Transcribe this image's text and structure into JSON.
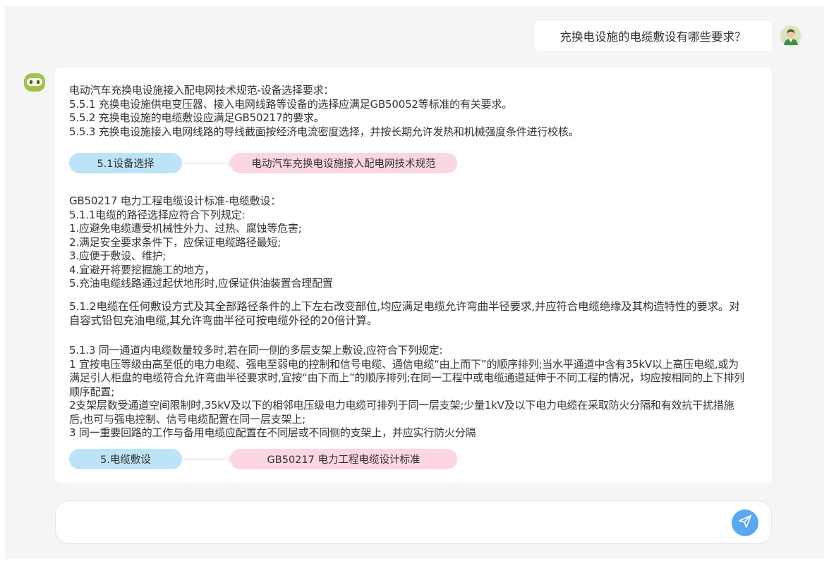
{
  "user_message": {
    "text": "充换电设施的电缆敷设有哪些要求？"
  },
  "bot_message": {
    "paragraph1": "电动汽车充换电设施接入配电网技术规范-设备选择要求：\n5.5.1 充换电设施供电变压器、接入电网线路等设备的选择应满足GB50052等标准的有关要求。\n5.5.2 充换电设施的电缆敷设应满足GB50217的要求。\n5.5.3 充换电设施接入电网线路的导线截面按经济电流密度选择，并按长期允许发热和机械强度条件进行校核。",
    "reference1": {
      "section": "5.1设备选择",
      "standard": "电动汽车充换电设施接入配电网技术规范"
    },
    "paragraph2": "GB50217 电力工程电缆设计标准-电缆敷设：\n5.1.1电缆的路径选择应符合下列规定:\n1.应避免电缆遭受机械性外力、过热、腐蚀等危害;\n2.满足安全要求条件下，应保证电缆路径最短;\n3.应便于敷设、维护;\n4.宜避开将要挖掘施工的地方，\n5.充油电缆线路通过起伏地形时,应保证供油装置合理配置",
    "paragraph3": "5.1.2电缆在任何敷设方式及其全部路径条件的上下左右改变部位,均应满足电缆允许弯曲半径要求,并应符合电缆绝缘及其构造特性的要求。对自容式铅包充油电缆,其允许弯曲半径可按电缆外径的20倍计算。",
    "paragraph4": "5.1.3 同一通道内电缆数量较多时,若在同一侧的多层支架上敷设,应符合下列规定:\n1 宜按电压等级由高至低的电力电缆、强电至弱电的控制和信号电缆、通信电缆“由上而下”的顺序排列;当水平通道中含有35kV以上高压电缆,或为满足引人柜盘的电缆符合允许弯曲半径要求时,宜按“由下而上”的顺序排列;在同一工程中或电缆通道延伸于不同工程的情况，均应按相同的上下排列顺序配置;\n2支架层数受通道空间限制时,35kV及以下的相邻电压级电力电缆可排列于同一层支架;少量1kV及以下电力电缆在采取防火分隔和有效抗干扰措施后,也可与强电控制、信号电缆配置在同一层支架上;\n3 同一重要回路的工作与备用电缆应配置在不同层或不同侧的支架上，并应实行防火分隔",
    "reference2": {
      "section": "5.电缆敷设",
      "standard": "GB50217 电力工程电缆设计标准"
    }
  },
  "input": {
    "value": "",
    "placeholder": ""
  },
  "icons": {
    "user_avatar": "user-avatar-icon",
    "bot_avatar": "robot-icon",
    "send": "paper-plane-icon"
  },
  "colors": {
    "section_chip": "#bde3f8",
    "standard_chip": "#fbd5e3",
    "send_button": "#5aa9f0",
    "bot_avatar": "#a3c24d"
  }
}
